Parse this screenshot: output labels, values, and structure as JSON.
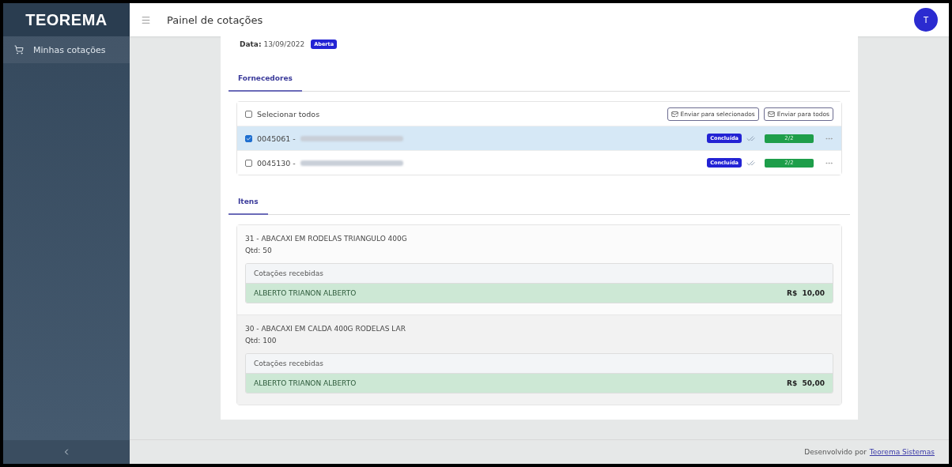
{
  "app": {
    "logo": "TEOREMA",
    "page_title": "Painel de cotações",
    "avatar": "T"
  },
  "sidebar": {
    "items": [
      {
        "label": "Minhas cotações",
        "selected": true
      }
    ]
  },
  "quote": {
    "date_label": "Data:",
    "date": "13/09/2022",
    "status": "Aberta"
  },
  "suppliers_tab": {
    "label": "Fornecedores",
    "selected": true
  },
  "select_all": {
    "label": "Selecionar todos",
    "checked": false
  },
  "actions": [
    "Enviar para selecionados",
    "Enviar para todos"
  ],
  "suppliers": [
    {
      "code": "0045061 -",
      "checked": true,
      "status": "Concluída",
      "progress": "2/2",
      "level": 1
    },
    {
      "code": "0045130 -",
      "checked": false,
      "status": "Concluída",
      "progress": "2/2",
      "level": 1
    }
  ],
  "items_tab": {
    "label": "Itens",
    "selected": true
  },
  "items": [
    {
      "title": "31 - ABACAXI EM RODELAS TRIANGULO 400G",
      "qty": "Qtd: 50",
      "quotes_heading": "Cotações recebidas",
      "quotes": [
        {
          "supplier": "ALBERTO TRIANON ALBERTO",
          "price": "R$  10,00"
        }
      ]
    },
    {
      "title": "30 - ABACAXI EM CALDA 400G RODELAS LAR",
      "qty": "Qtd: 100",
      "quotes_heading": "Cotações recebidas",
      "quotes": [
        {
          "supplier": "ALBERTO TRIANON ALBERTO",
          "price": "R$  50,00"
        }
      ]
    }
  ],
  "footer": {
    "text": "Desenvolvido por",
    "link": "Teorema Sistemas"
  }
}
